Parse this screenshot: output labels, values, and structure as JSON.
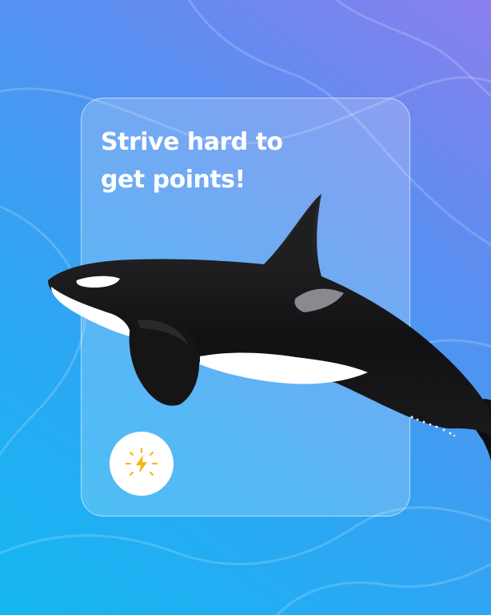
{
  "headline": "Strive hard to get points!",
  "colors": {
    "gradient_start": "#14b7f2",
    "gradient_end": "#8a7fee",
    "text": "#ffffff",
    "badge_bg": "#ffffff",
    "badge_icon": "#f5b50a"
  },
  "badge": {
    "icon": "lightning-bolt-icon"
  },
  "illustration": {
    "subject": "orca-image"
  }
}
